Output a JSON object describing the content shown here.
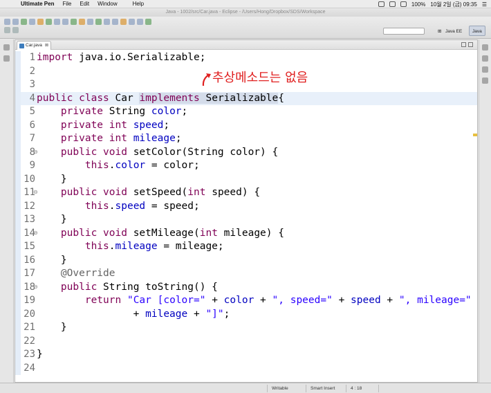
{
  "menubar": {
    "app_name": "Ultimate Pen",
    "items": [
      "File",
      "Edit",
      "Window",
      "Help"
    ],
    "battery": "100%",
    "clock": "10월 2일 (금)  09:35"
  },
  "window": {
    "title": "Java - 1002/src/Car.java - Eclipse - /Users/Hong/Dropbox/SDS/Workspace"
  },
  "perspectives": [
    {
      "label": "Java EE"
    },
    {
      "label": "Java"
    }
  ],
  "editor": {
    "tab_label": "Car.java",
    "tab_close": "⊠",
    "annotation_text": "추상메소드는 없음"
  },
  "code_lines": [
    {
      "n": "1",
      "text": "import java.io.Serializable;"
    },
    {
      "n": "2",
      "text": ""
    },
    {
      "n": "3",
      "text": ""
    },
    {
      "n": "4",
      "text": "public class Car implements Serializable{"
    },
    {
      "n": "5",
      "text": "    private String color;"
    },
    {
      "n": "6",
      "text": "    private int speed;"
    },
    {
      "n": "7",
      "text": "    private int mileage;"
    },
    {
      "n": "8",
      "text": "    public void setColor(String color) {"
    },
    {
      "n": "9",
      "text": "        this.color = color;"
    },
    {
      "n": "10",
      "text": "    }"
    },
    {
      "n": "11",
      "text": "    public void setSpeed(int speed) {"
    },
    {
      "n": "12",
      "text": "        this.speed = speed;"
    },
    {
      "n": "13",
      "text": "    }"
    },
    {
      "n": "14",
      "text": "    public void setMileage(int mileage) {"
    },
    {
      "n": "15",
      "text": "        this.mileage = mileage;"
    },
    {
      "n": "16",
      "text": "    }"
    },
    {
      "n": "17",
      "text": "    @Override"
    },
    {
      "n": "18",
      "text": "    public String toString() {"
    },
    {
      "n": "19",
      "text": "        return \"Car [color=\" + color + \", speed=\" + speed + \", mileage=\""
    },
    {
      "n": "20",
      "text": "                + mileage + \"]\";"
    },
    {
      "n": "21",
      "text": "    }"
    },
    {
      "n": "22",
      "text": ""
    },
    {
      "n": "23",
      "text": "}"
    },
    {
      "n": "24",
      "text": ""
    }
  ],
  "statusbar": {
    "mode": "Writable",
    "insert": "Smart Insert",
    "position": "4 : 18"
  },
  "colors": {
    "keyword": "#7f0055",
    "field": "#0000c0",
    "string": "#2a00ff",
    "annotation": "#e02020"
  }
}
